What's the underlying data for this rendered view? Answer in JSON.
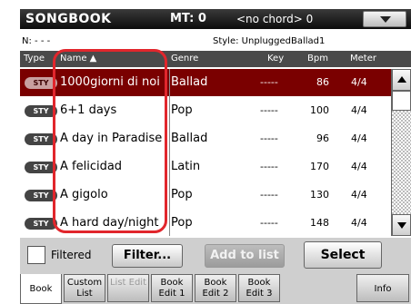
{
  "title": {
    "app": "SONGBOOK",
    "mt": "MT: 0",
    "chord": "<no chord> 0"
  },
  "info": {
    "n": "N: - - -",
    "style": "Style: UnpluggedBallad1"
  },
  "columns": [
    "Type",
    "Name ▲",
    "Genre",
    "Key",
    "Bpm",
    "Meter"
  ],
  "rows": [
    {
      "type": "STY",
      "name": "1000giorni di noi",
      "genre": "Ballad",
      "key": "-----",
      "bpm": "86",
      "meter": "4/4",
      "selected": true
    },
    {
      "type": "STY",
      "name": "6+1 days",
      "genre": "Pop",
      "key": "-----",
      "bpm": "100",
      "meter": "4/4"
    },
    {
      "type": "STY",
      "name": "A day in Paradise",
      "genre": "Ballad",
      "key": "-----",
      "bpm": "96",
      "meter": "4/4"
    },
    {
      "type": "STY",
      "name": "A felicidad",
      "genre": "Latin",
      "key": "-----",
      "bpm": "170",
      "meter": "4/4"
    },
    {
      "type": "STY",
      "name": "A gigolo",
      "genre": "Pop",
      "key": "-----",
      "bpm": "130",
      "meter": "4/4"
    },
    {
      "type": "STY",
      "name": "A hard day/night",
      "genre": "Pop",
      "key": "-----",
      "bpm": "148",
      "meter": "4/4"
    }
  ],
  "controls": {
    "filtered": "Filtered",
    "filter": "Filter...",
    "add_to_list": "Add to list",
    "select": "Select"
  },
  "tabs": [
    {
      "label": "Book",
      "active": true
    },
    {
      "label": "Custom List"
    },
    {
      "label": "List Edit",
      "disabled": true
    },
    {
      "label": "Book Edit 1"
    },
    {
      "label": "Book Edit 2"
    },
    {
      "label": "Book Edit 3"
    },
    {
      "label": "Info"
    }
  ],
  "colors": {
    "selected_row": "#7a0000",
    "highlight_border": "#e1262c"
  }
}
